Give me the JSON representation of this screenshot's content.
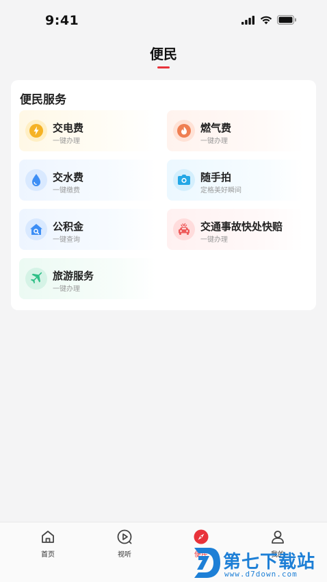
{
  "status_bar": {
    "time": "9:41"
  },
  "header": {
    "title": "便民"
  },
  "section": {
    "title": "便民服务"
  },
  "services": [
    {
      "label": "交电费",
      "sub": "一键办理",
      "icon": "lightning-icon",
      "color": "#f5b224"
    },
    {
      "label": "燃气费",
      "sub": "一键办理",
      "icon": "flame-icon",
      "color": "#ef7f52"
    },
    {
      "label": "交水费",
      "sub": "一键缴费",
      "icon": "water-drop-icon",
      "color": "#3d8ef5"
    },
    {
      "label": "随手拍",
      "sub": "定格美好瞬间",
      "icon": "camera-icon",
      "color": "#23a7e6"
    },
    {
      "label": "公积金",
      "sub": "一键查询",
      "icon": "house-search-icon",
      "color": "#3d8ef5"
    },
    {
      "label": "交通事故快处快赔",
      "sub": "一键办理",
      "icon": "car-accident-icon",
      "color": "#ee5a5a"
    },
    {
      "label": "旅游服务",
      "sub": "一键办理",
      "icon": "airplane-icon",
      "color": "#2fbf87"
    }
  ],
  "nav": [
    {
      "label": "首页",
      "icon": "home-icon"
    },
    {
      "label": "视听",
      "icon": "play-icon"
    },
    {
      "label": "便民",
      "icon": "compass-icon",
      "active": true
    },
    {
      "label": "我的",
      "icon": "user-icon"
    }
  ],
  "watermark": {
    "text": "第七下载站",
    "url": "www.d7down.com"
  }
}
